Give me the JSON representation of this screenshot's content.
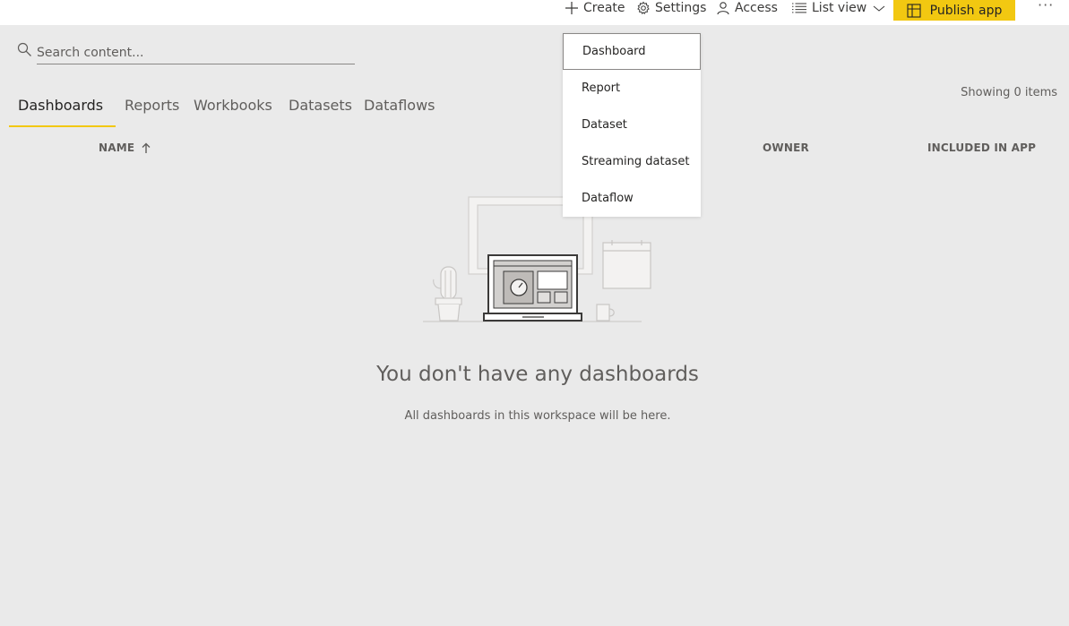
{
  "toolbar": {
    "create_label": "Create",
    "settings_label": "Settings",
    "access_label": "Access",
    "view_label": "List view",
    "publish_label": "Publish app",
    "more_label": "···"
  },
  "search": {
    "placeholder": "Search content..."
  },
  "tabs": [
    {
      "label": "Dashboards",
      "active": true
    },
    {
      "label": "Reports",
      "active": false
    },
    {
      "label": "Workbooks",
      "active": false
    },
    {
      "label": "Datasets",
      "active": false
    },
    {
      "label": "Dataflows",
      "active": false
    }
  ],
  "showing_text": "Showing 0 items",
  "columns": {
    "name": "NAME",
    "owner": "OWNER",
    "included": "INCLUDED IN APP"
  },
  "empty_state": {
    "title": "You don't have any dashboards",
    "subtitle": "All dashboards in this workspace will be here."
  },
  "create_menu": {
    "items": [
      {
        "label": "Dashboard"
      },
      {
        "label": "Report"
      },
      {
        "label": "Dataset"
      },
      {
        "label": "Streaming dataset"
      },
      {
        "label": "Dataflow"
      }
    ]
  },
  "colors": {
    "accent": "#f2c811",
    "background": "#eaeaea",
    "text": "#252423",
    "muted_text": "#605e5c"
  },
  "icons": [
    "plus-icon",
    "gear-icon",
    "person-icon",
    "list-icon",
    "chevron-down-icon",
    "app-icon",
    "search-icon",
    "sort-arrow-up-icon"
  ]
}
